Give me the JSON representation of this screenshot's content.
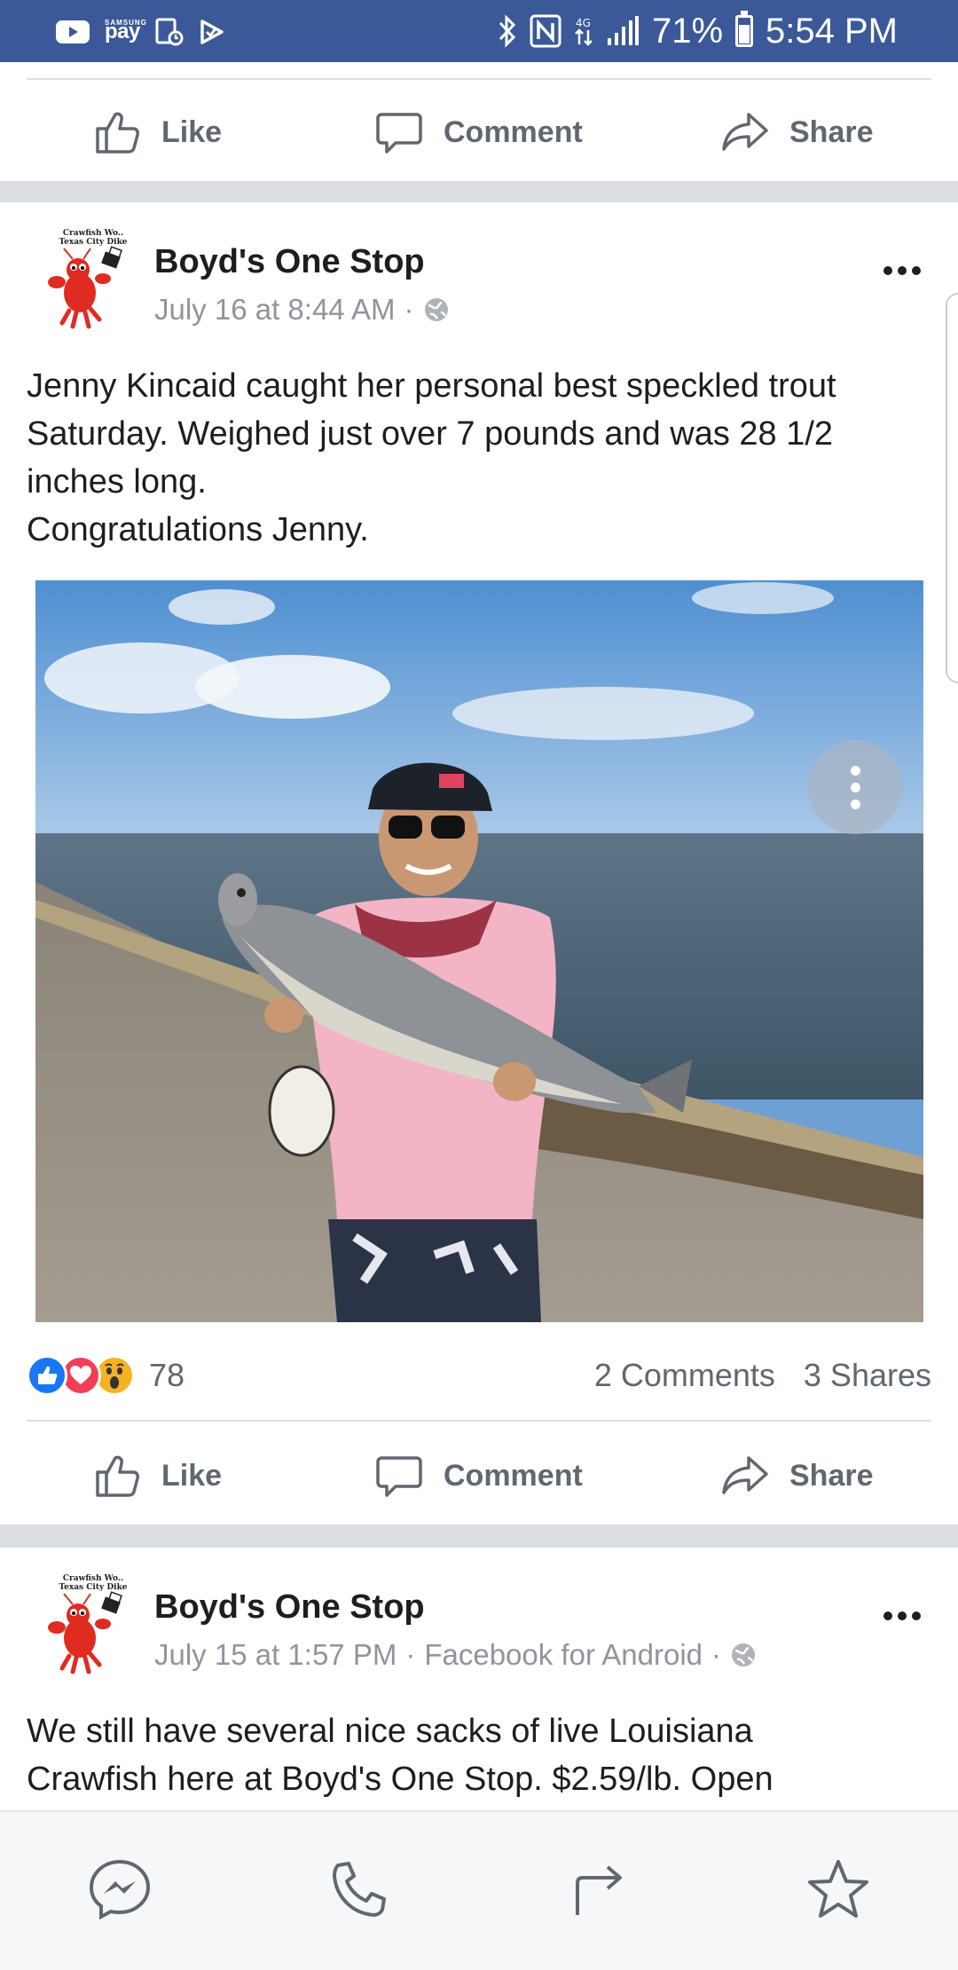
{
  "status_bar": {
    "left_icons": [
      "youtube-icon",
      "samsung-pay-icon",
      "screenshot-icon",
      "check-icon"
    ],
    "pay_text": "pay",
    "pay_brand": "SAMSUNG",
    "right_icons": [
      "bluetooth-icon",
      "nfc-icon",
      "data-icon",
      "signal-icon"
    ],
    "battery_percent": "71%",
    "battery_level": 0.71,
    "time": "5:54 PM",
    "color": "#3b5998"
  },
  "actions": {
    "like": "Like",
    "comment": "Comment",
    "share": "Share"
  },
  "post": {
    "page_name": "Boyd's One Stop",
    "avatar_caption_line1": "Crawfish Wo..",
    "avatar_caption_line2": "Texas City Dike",
    "timestamp": "July 16 at 8:44 AM",
    "separator": "·",
    "text_lines": [
      "Jenny Kincaid caught her personal best speckled trout",
      "Saturday. Weighed just over 7 pounds and was 28 1/2",
      "inches long.",
      "Congratulations Jenny."
    ],
    "reaction_icons": [
      "like-reaction-icon",
      "love-reaction-icon",
      "wow-reaction-icon"
    ],
    "reaction_count": "78",
    "comments": "2 Comments",
    "shares": "3 Shares"
  },
  "next_post": {
    "page_name": "Boyd's One Stop",
    "avatar_caption_line1": "Crawfish Wo..",
    "avatar_caption_line2": "Texas City Dike",
    "timestamp": "July 15 at 1:57 PM",
    "source": "Facebook for Android",
    "separator": "·",
    "text_lines": [
      "We still have several nice sacks of live Louisiana",
      "Crawfish here at Boyd's One Stop. $2.59/lb. Open"
    ]
  },
  "bottom_nav": [
    "messenger-icon",
    "phone-icon",
    "forward-icon",
    "star-icon"
  ],
  "colors": {
    "facebook_blue": "#3b5998",
    "like_blue": "#1877f2",
    "love_red": "#f33e58",
    "wow_yellow": "#f7b125",
    "secondary_text": "#606770"
  }
}
